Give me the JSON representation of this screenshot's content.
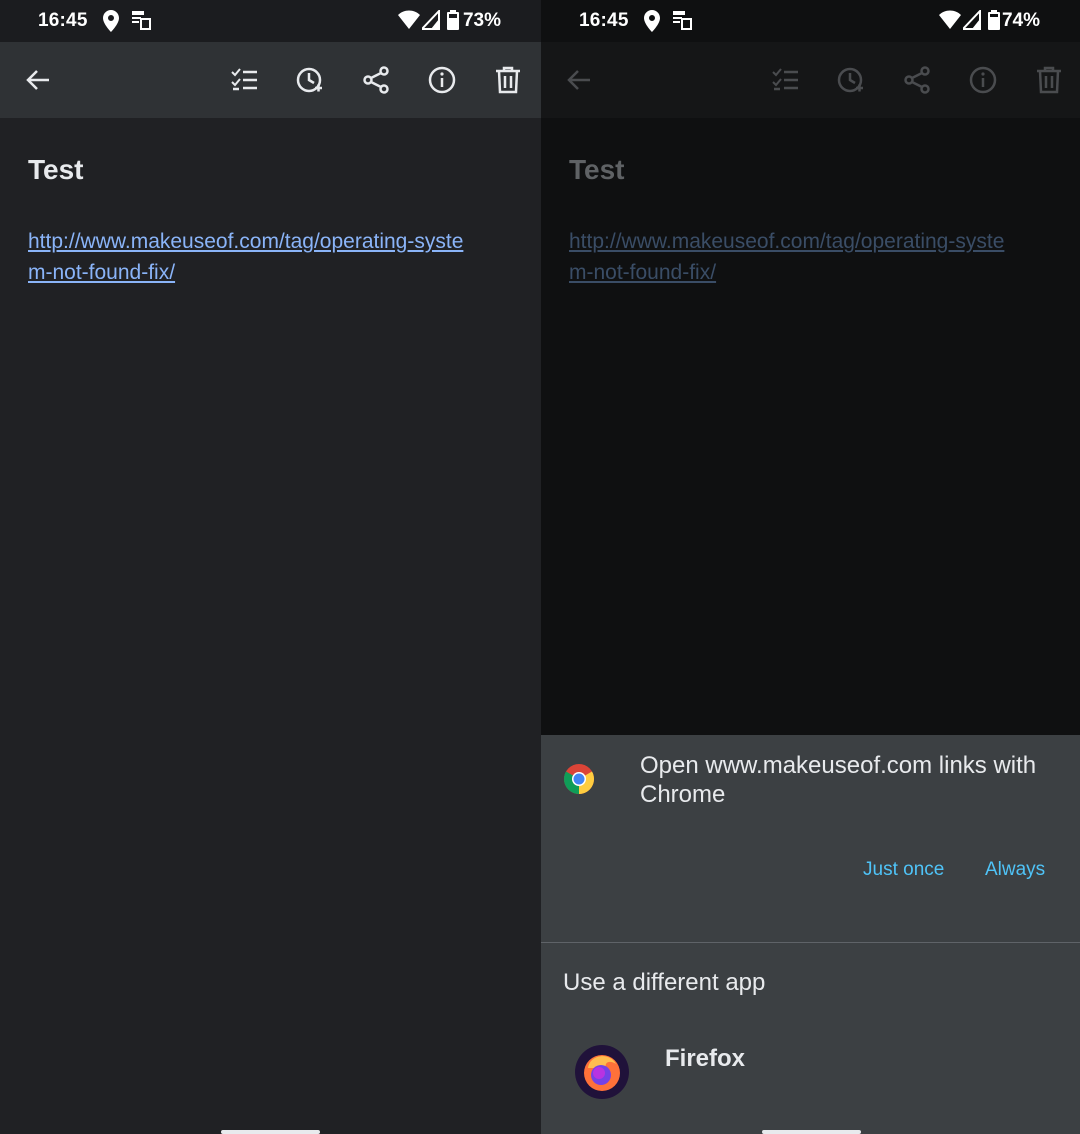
{
  "left": {
    "status": {
      "time": "16:45",
      "battery": "73%"
    },
    "note": {
      "title": "Test",
      "link": "http://www.makeuseof.com/tag/operating-system-not-found-fix/"
    }
  },
  "right": {
    "status": {
      "time": "16:45",
      "battery": "74%"
    },
    "note": {
      "title": "Test",
      "link": "http://www.makeuseof.com/tag/operating-system-not-found-fix/"
    },
    "sheet": {
      "title": "Open www.makeuseof.com links with Chrome",
      "just_once": "Just once",
      "always": "Always",
      "different_app": "Use a different app",
      "app_name": "Firefox"
    }
  },
  "icons": {
    "toolbar": [
      "back-arrow-icon",
      "checklist-icon",
      "reminder-icon",
      "share-icon",
      "info-icon",
      "delete-icon"
    ],
    "status": [
      "location-icon",
      "cast-icon",
      "wifi-icon",
      "cell-signal-icon",
      "battery-icon"
    ]
  },
  "colors": {
    "link": "#8ab4f8",
    "accent": "#4fc3f7",
    "sheet": "#3c4043",
    "background": "#202124"
  }
}
